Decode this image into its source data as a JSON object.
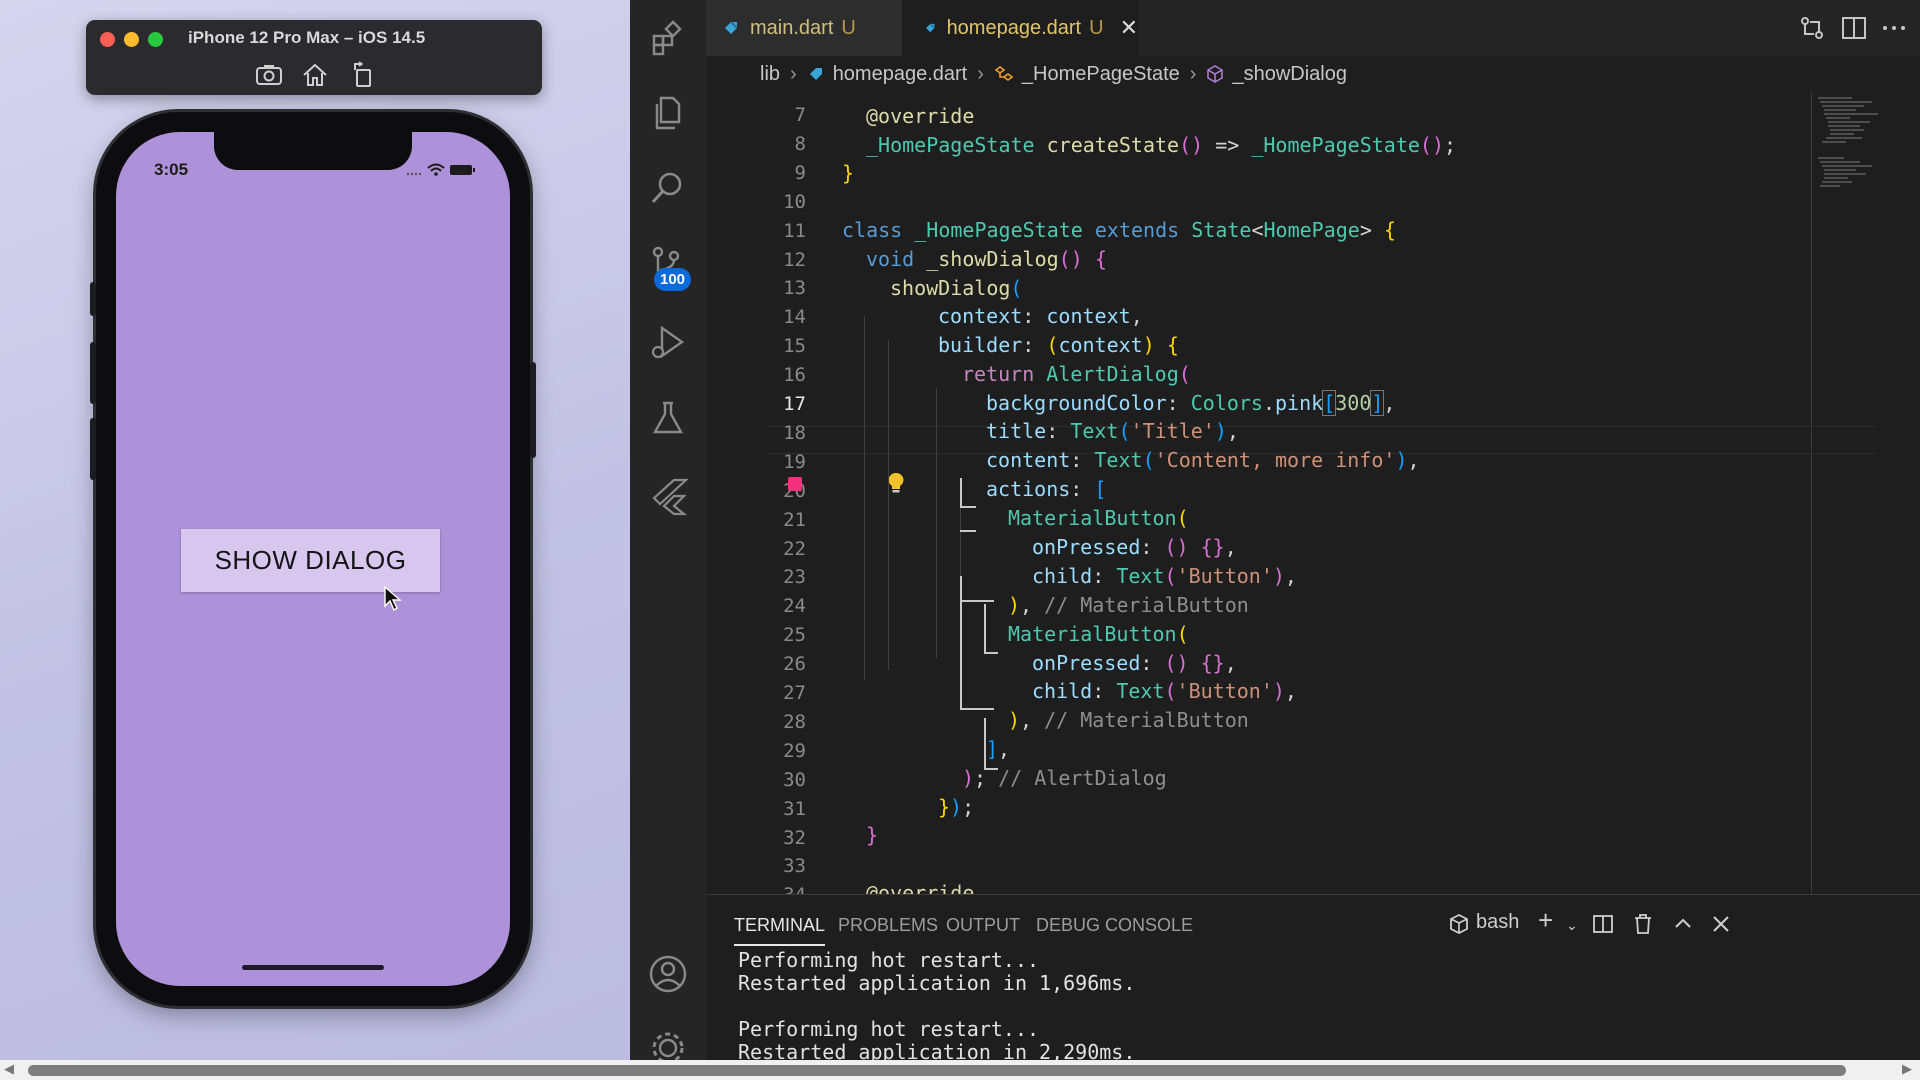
{
  "simulator": {
    "title": "iPhone 12 Pro Max – iOS 14.5",
    "toolbar_icons": [
      "screenshot-icon",
      "home-icon",
      "rotate-icon"
    ],
    "status_time": "3:05",
    "screen_color": "#ad92d9",
    "button_label": "SHOW DIALOG"
  },
  "editor_tabs": [
    {
      "label": "main.dart",
      "modified": "U",
      "active": false
    },
    {
      "label": "homepage.dart",
      "modified": "U",
      "active": true
    }
  ],
  "breadcrumb": [
    "lib",
    "homepage.dart",
    "_HomePageState",
    "_showDialog"
  ],
  "activity_bar": {
    "scm_badge": "100"
  },
  "code": {
    "line_numbers": [
      "7",
      "8",
      "9",
      "10",
      "11",
      "12",
      "13",
      "14",
      "15",
      "16",
      "17",
      "18",
      "19",
      "20",
      "21",
      "22",
      "23",
      "24",
      "25",
      "26",
      "27",
      "28",
      "29",
      "30",
      "31",
      "32",
      "33",
      "34"
    ],
    "current_line": "17"
  },
  "panel": {
    "tabs": [
      "TERMINAL",
      "PROBLEMS",
      "OUTPUT",
      "DEBUG CONSOLE"
    ],
    "shell": "bash",
    "terminal_lines": [
      "Performing hot restart...",
      "Restarted application in 1,696ms.",
      "",
      "Performing hot restart...",
      "Restarted application in 2,290ms."
    ]
  },
  "colors": {
    "accent_scm_badge": "#0a6ad9",
    "breakpoint": "#f0317b"
  }
}
